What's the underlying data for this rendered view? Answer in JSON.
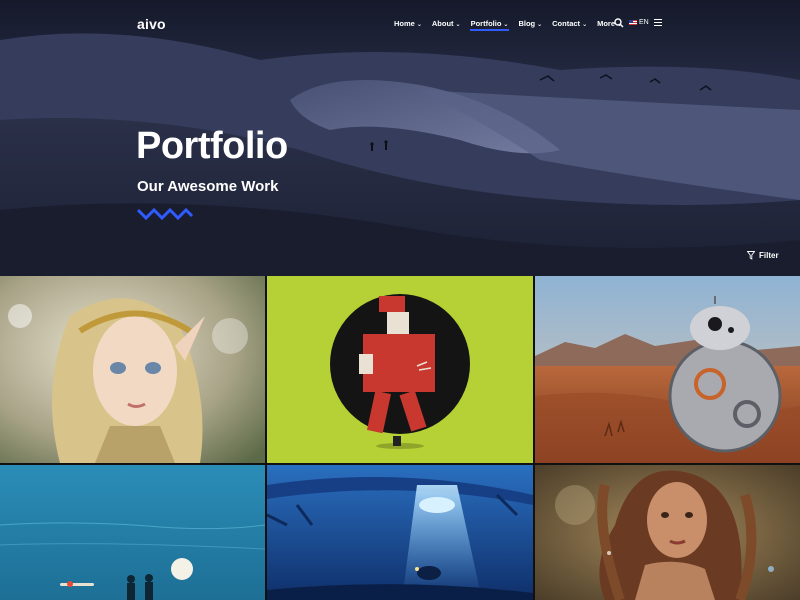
{
  "brand": {
    "logo": "aivo",
    "accent": "#2f5bff"
  },
  "nav": {
    "items": [
      {
        "label": "Home",
        "active": false
      },
      {
        "label": "About",
        "active": false
      },
      {
        "label": "Portfolio",
        "active": true
      },
      {
        "label": "Blog",
        "active": false
      },
      {
        "label": "Contact",
        "active": false
      },
      {
        "label": "More",
        "active": false
      }
    ],
    "chevron": "⌄",
    "language": "EN",
    "search_icon": "search-icon",
    "menu_icon": "hamburger-icon"
  },
  "hero": {
    "title": "Portfolio",
    "subtitle": "Our Awesome Work",
    "filter_label": "Filter"
  },
  "portfolio": {
    "items": [
      {
        "subject": "elf girl portrait",
        "bg": "#c9c2a8"
      },
      {
        "subject": "red robot skeleton on green",
        "bg": "#b7d23a"
      },
      {
        "subject": "spherical droid in desert",
        "bg": "#b8653a"
      },
      {
        "subject": "two figures under moon by sea",
        "bg": "#2a8bb0"
      },
      {
        "subject": "underwater submarine light",
        "bg": "#1b5aa6"
      },
      {
        "subject": "woman with curly hair portrait",
        "bg": "#8a6a3e"
      }
    ]
  }
}
